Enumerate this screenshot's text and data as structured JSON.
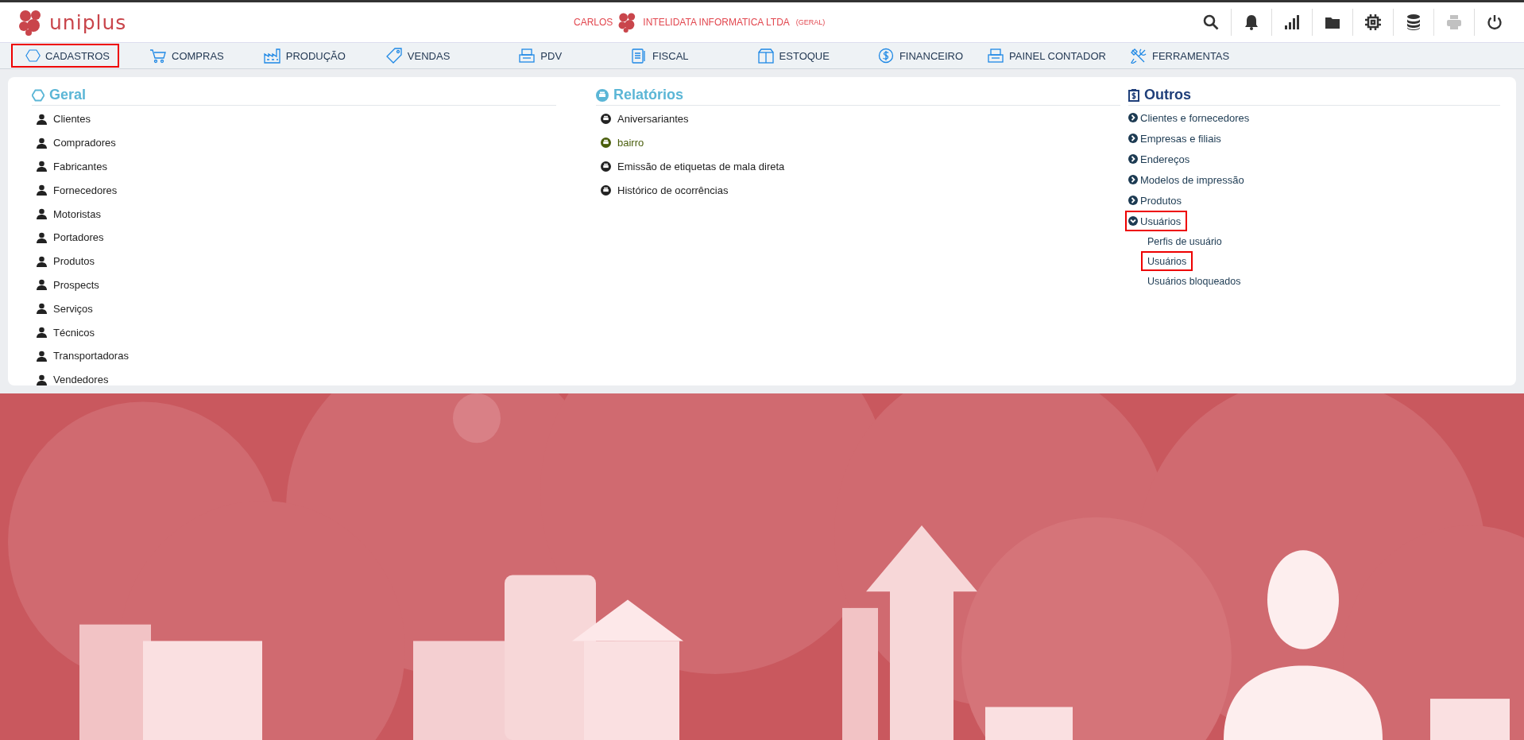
{
  "header": {
    "logo_text": "uniplus",
    "user": "CARLOS",
    "company": "INTELIDATA INFORMATICA LTDA",
    "company_scope": "(GERAL)",
    "toolbar": [
      {
        "kind": "search",
        "disabled": false
      },
      {
        "kind": "bell",
        "disabled": false
      },
      {
        "kind": "chart",
        "disabled": false
      },
      {
        "kind": "folder",
        "disabled": false
      },
      {
        "kind": "chip",
        "disabled": false
      },
      {
        "kind": "database",
        "disabled": false
      },
      {
        "kind": "printer",
        "disabled": true
      },
      {
        "kind": "power",
        "disabled": false
      }
    ]
  },
  "menu": [
    {
      "label": "CADASTROS",
      "kind": "hexagon",
      "highlighted": true
    },
    {
      "label": "COMPRAS",
      "kind": "cart",
      "highlighted": false
    },
    {
      "label": "PRODUÇÃO",
      "kind": "factory",
      "highlighted": false
    },
    {
      "label": "VENDAS",
      "kind": "tag",
      "highlighted": false
    },
    {
      "label": "PDV",
      "kind": "register",
      "highlighted": false
    },
    {
      "label": "FISCAL",
      "kind": "document",
      "highlighted": false
    },
    {
      "label": "ESTOQUE",
      "kind": "box",
      "highlighted": false
    },
    {
      "label": "FINANCEIRO",
      "kind": "dollar",
      "highlighted": false
    },
    {
      "label": "PAINEL CONTADOR",
      "kind": "register",
      "highlighted": false
    },
    {
      "label": "FERRAMENTAS",
      "kind": "tools",
      "highlighted": false
    }
  ],
  "geral": {
    "title": "Geral",
    "items": [
      "Clientes",
      "Compradores",
      "Fabricantes",
      "Fornecedores",
      "Motoristas",
      "Portadores",
      "Produtos",
      "Prospects",
      "Serviços",
      "Técnicos",
      "Transportadoras",
      "Vendedores"
    ]
  },
  "relatorios": {
    "title": "Relatórios",
    "items": [
      {
        "label": "Aniversariantes",
        "color": "#222222"
      },
      {
        "label": "bairro",
        "color": "#4a5e0c"
      },
      {
        "label": "Emissão de etiquetas de mala direta",
        "color": "#222222"
      },
      {
        "label": "Histórico de ocorrências",
        "color": "#222222"
      }
    ]
  },
  "outros": {
    "title": "Outros",
    "items": [
      {
        "label": "Clientes e fornecedores",
        "expanded": false,
        "highlighted": false
      },
      {
        "label": "Empresas e filiais",
        "expanded": false,
        "highlighted": false
      },
      {
        "label": "Endereços",
        "expanded": false,
        "highlighted": false
      },
      {
        "label": "Modelos de impressão",
        "expanded": false,
        "highlighted": false
      },
      {
        "label": "Produtos",
        "expanded": false,
        "highlighted": false
      },
      {
        "label": "Usuários",
        "expanded": true,
        "highlighted": true,
        "children": [
          {
            "label": "Perfis de usuário",
            "highlighted": false
          },
          {
            "label": "Usuários",
            "highlighted": true
          },
          {
            "label": "Usuários bloqueados",
            "highlighted": false
          }
        ]
      }
    ]
  }
}
